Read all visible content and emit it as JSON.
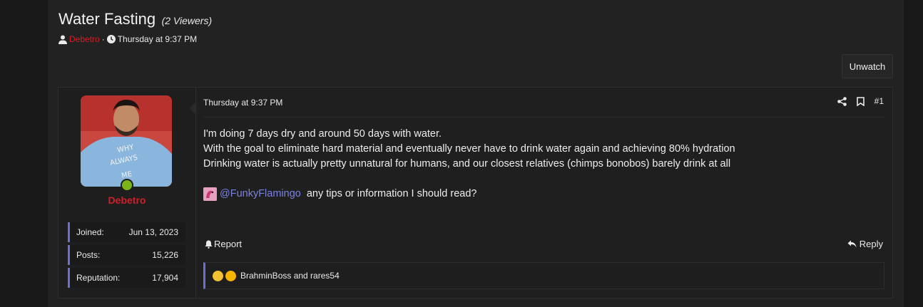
{
  "thread": {
    "title": "Water Fasting",
    "viewers": "(2 Viewers)",
    "author": "Debetro",
    "separator": "·",
    "date": "Thursday at 9:37 PM",
    "unwatch_label": "Unwatch"
  },
  "post": {
    "username": "Debetro",
    "stats": [
      {
        "label": "Joined:",
        "value": "Jun 13, 2023"
      },
      {
        "label": "Posts:",
        "value": "15,226"
      },
      {
        "label": "Reputation:",
        "value": "17,904"
      }
    ],
    "date": "Thursday at 9:37 PM",
    "number": "#1",
    "lines": [
      "I'm doing 7 days dry and around 50 days with water.",
      "With the goal to eliminate hard material and eventually never have to drink water again and achieving 80% hydration",
      "Drinking water is actually pretty unnatural for humans, and our closest relatives (chimps bonobos) barely drink at all"
    ],
    "mention": "@FunkyFlamingo",
    "mention_text": " any tips or information I should read?",
    "report_label": "Report",
    "reply_label": "Reply",
    "reactions_text": "BrahminBoss and rares54"
  },
  "icons": [
    "user-icon",
    "clock-icon",
    "share-icon",
    "bookmark-icon",
    "bell-icon",
    "reply-icon"
  ],
  "colors": {
    "accent": "#6b6fd4",
    "username": "#d11f2a",
    "online": "#7cb518",
    "mention": "#7a82e0"
  }
}
